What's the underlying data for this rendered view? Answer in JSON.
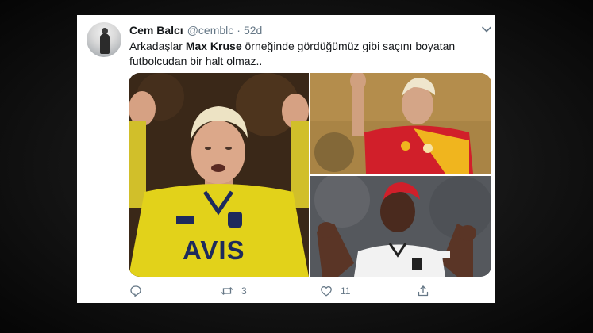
{
  "tweet": {
    "display_name": "Cem Balcı",
    "handle": "@cemblc",
    "separator": "·",
    "time": "52d",
    "text_prefix": "Arkadaşlar ",
    "text_bold": "Max Kruse",
    "text_suffix": " örneğinde gördüğümüz gibi saçını boyatan futbolcudan bir halt olmaz.."
  },
  "media": {
    "main_jersey_text": "AVIS"
  },
  "actions": {
    "reply_icon": "reply-icon",
    "retweet_icon": "retweet-icon",
    "retweet_count": "3",
    "like_icon": "heart-icon",
    "like_count": "11",
    "share_icon": "share-icon"
  },
  "colors": {
    "text_primary": "#14171a",
    "text_secondary": "#657786",
    "background": "#000000",
    "card": "#ffffff"
  }
}
